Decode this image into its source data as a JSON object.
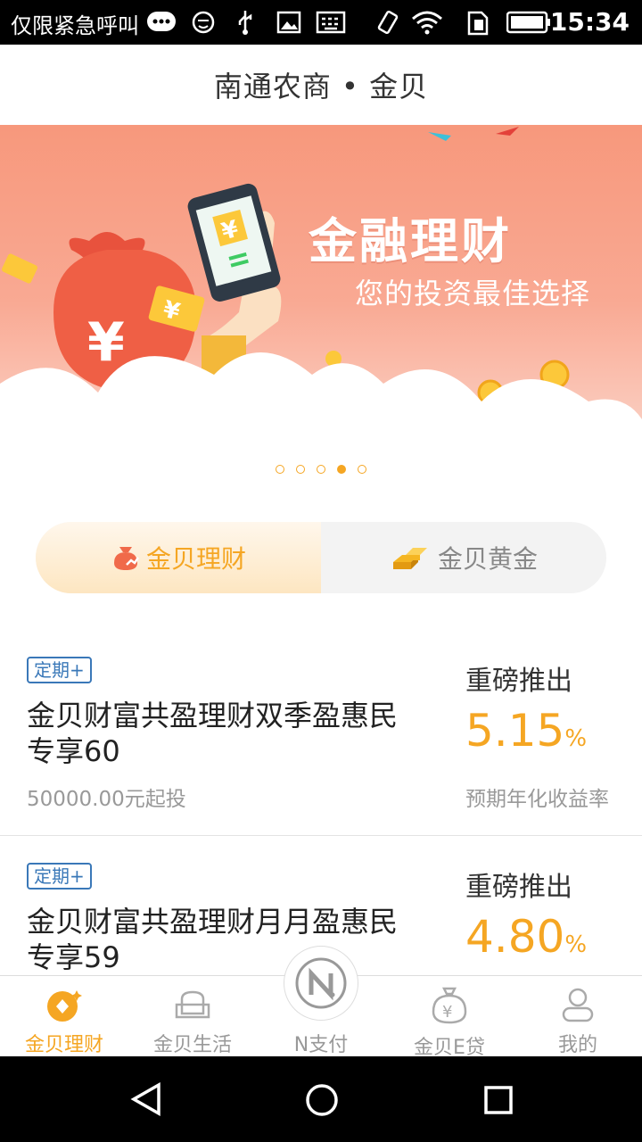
{
  "status_bar": {
    "carrier": "仅限紧急呼叫",
    "time": "15:34",
    "icons": [
      "message-icon",
      "face-icon",
      "usb-icon",
      "image-icon",
      "keyboard-icon",
      "rotate-icon",
      "wifi-icon",
      "sim-icon",
      "battery-icon"
    ]
  },
  "header": {
    "title": "南通农商 • 金贝"
  },
  "banner": {
    "headline": "金融理财",
    "subline": "您的投资最佳选择",
    "currency_symbol": "¥",
    "active_index": 3,
    "count": 5
  },
  "segment": {
    "tabs": [
      {
        "label": "金贝理财",
        "icon": "money-bag-icon",
        "active": true
      },
      {
        "label": "金贝黄金",
        "icon": "gold-bars-icon",
        "active": false
      }
    ]
  },
  "products": [
    {
      "badge": "定期+",
      "name": "金贝财富共盈理财双季盈惠民专享60",
      "min_invest": "50000.00元起投",
      "promo": "重磅推出",
      "rate": "5.15",
      "rate_unit": "%",
      "rate_label": "预期年化收益率"
    },
    {
      "badge": "定期+",
      "name": "金贝财富共盈理财月月盈惠民专享59",
      "promo": "重磅推出",
      "rate": "4.80",
      "rate_unit": "%"
    }
  ],
  "tabbar": {
    "items": [
      {
        "label": "金贝理财",
        "icon": "finance-coin-icon",
        "active": true
      },
      {
        "label": "金贝生活",
        "icon": "sofa-icon",
        "active": false
      },
      {
        "label": "N支付",
        "icon": "n-pay-icon",
        "active": false
      },
      {
        "label": "金贝E贷",
        "icon": "loan-bag-icon",
        "active": false
      },
      {
        "label": "我的",
        "icon": "user-icon",
        "active": false
      }
    ]
  },
  "colors": {
    "accent": "#f5a623",
    "badge": "#3a78b8",
    "banner": "#f7987c"
  }
}
